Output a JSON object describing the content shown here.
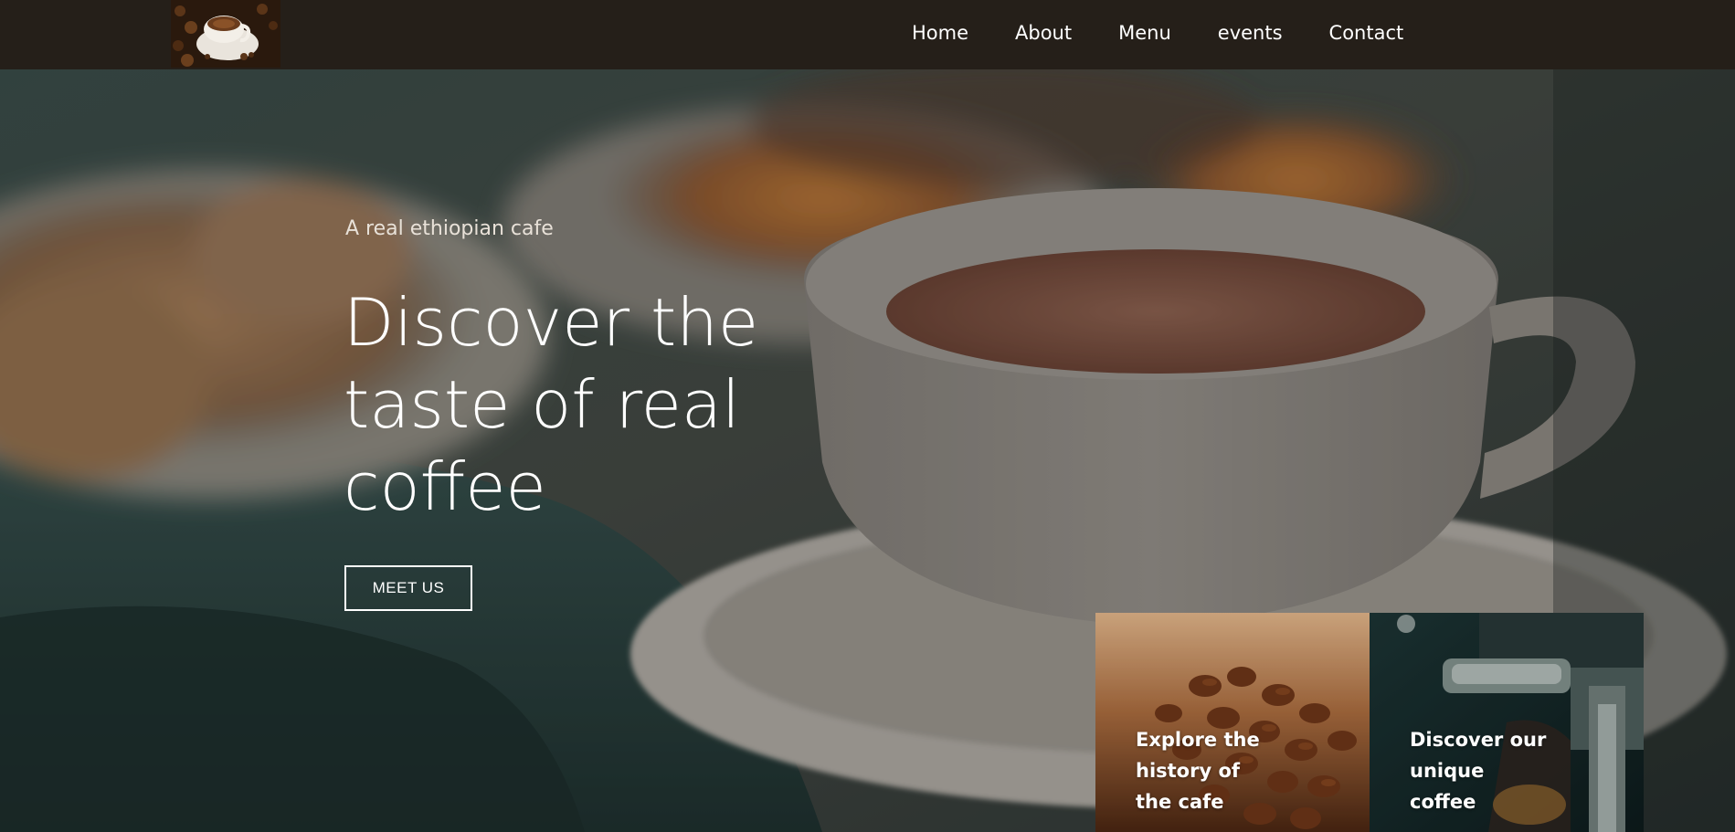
{
  "nav": {
    "logo_alt": "cafe logo",
    "links": [
      "Home",
      "About",
      "Menu",
      "events",
      "Contact"
    ]
  },
  "hero": {
    "subtitle": "A real ethiopian cafe",
    "title": "Discover the taste of real coffee",
    "button_label": "MEET US"
  },
  "cards": [
    {
      "text": "Explore the history of the cafe",
      "image": "coffee-beans"
    },
    {
      "text": "Discover our unique coffee",
      "image": "espresso-machine"
    }
  ],
  "colors": {
    "navbar_bg": "#251f19",
    "text_primary": "#ffffff",
    "text_subtitle": "#e8e1d8"
  }
}
